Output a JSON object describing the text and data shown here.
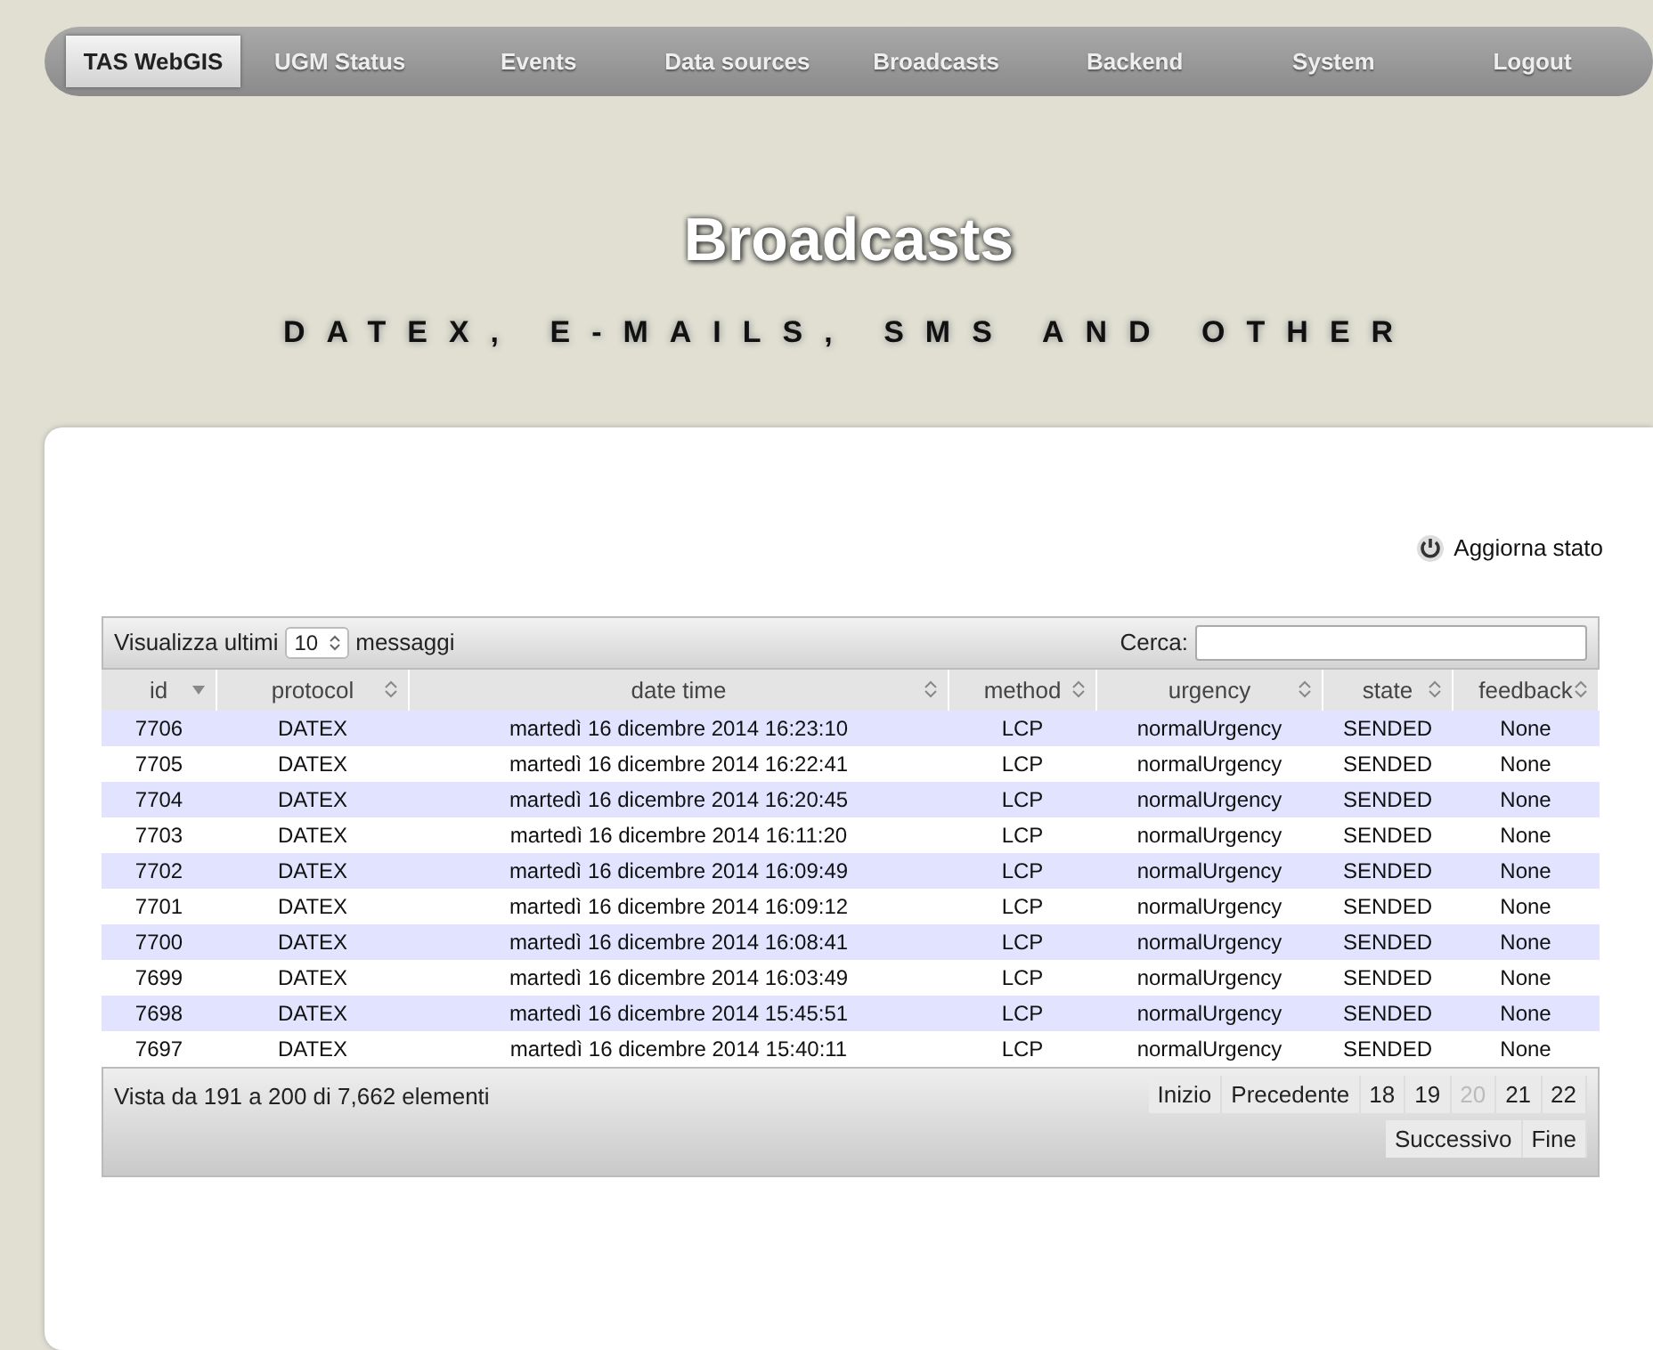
{
  "nav": [
    {
      "label": "TAS WebGIS",
      "selected": true
    },
    {
      "label": "UGM Status",
      "selected": false
    },
    {
      "label": "Events",
      "selected": false
    },
    {
      "label": "Data sources",
      "selected": false
    },
    {
      "label": "Broadcasts",
      "selected": false
    },
    {
      "label": "Backend",
      "selected": false
    },
    {
      "label": "System",
      "selected": false
    },
    {
      "label": "Logout",
      "selected": false
    }
  ],
  "title": "Broadcasts",
  "subtitle": "DATEX, E-MAILS, SMS AND OTHER",
  "refresh": "Aggiorna stato",
  "table": {
    "length_label_before": "Visualizza ultimi",
    "length_value": "10",
    "length_label_after": "messaggi",
    "search_label": "Cerca:",
    "columns": [
      {
        "label": "id",
        "sorted": true
      },
      {
        "label": "protocol",
        "sorted": false
      },
      {
        "label": "date time",
        "sorted": false
      },
      {
        "label": "method",
        "sorted": false
      },
      {
        "label": "urgency",
        "sorted": false
      },
      {
        "label": "state",
        "sorted": false
      },
      {
        "label": "feedback",
        "sorted": false
      }
    ],
    "rows": [
      [
        "7706",
        "DATEX",
        "martedì 16 dicembre 2014 16:23:10",
        "LCP",
        "normalUrgency",
        "SENDED",
        "None"
      ],
      [
        "7705",
        "DATEX",
        "martedì 16 dicembre 2014 16:22:41",
        "LCP",
        "normalUrgency",
        "SENDED",
        "None"
      ],
      [
        "7704",
        "DATEX",
        "martedì 16 dicembre 2014 16:20:45",
        "LCP",
        "normalUrgency",
        "SENDED",
        "None"
      ],
      [
        "7703",
        "DATEX",
        "martedì 16 dicembre 2014 16:11:20",
        "LCP",
        "normalUrgency",
        "SENDED",
        "None"
      ],
      [
        "7702",
        "DATEX",
        "martedì 16 dicembre 2014 16:09:49",
        "LCP",
        "normalUrgency",
        "SENDED",
        "None"
      ],
      [
        "7701",
        "DATEX",
        "martedì 16 dicembre 2014 16:09:12",
        "LCP",
        "normalUrgency",
        "SENDED",
        "None"
      ],
      [
        "7700",
        "DATEX",
        "martedì 16 dicembre 2014 16:08:41",
        "LCP",
        "normalUrgency",
        "SENDED",
        "None"
      ],
      [
        "7699",
        "DATEX",
        "martedì 16 dicembre 2014 16:03:49",
        "LCP",
        "normalUrgency",
        "SENDED",
        "None"
      ],
      [
        "7698",
        "DATEX",
        "martedì 16 dicembre 2014 15:45:51",
        "LCP",
        "normalUrgency",
        "SENDED",
        "None"
      ],
      [
        "7697",
        "DATEX",
        "martedì 16 dicembre 2014 15:40:11",
        "LCP",
        "normalUrgency",
        "SENDED",
        "None"
      ]
    ],
    "info": "Vista da 191 a 200 di 7,662 elementi",
    "pages": [
      {
        "label": "Inizio",
        "selected": false
      },
      {
        "label": "Precedente",
        "selected": false
      },
      {
        "label": "18",
        "selected": false
      },
      {
        "label": "19",
        "selected": false
      },
      {
        "label": "20",
        "selected": true
      },
      {
        "label": "21",
        "selected": false
      },
      {
        "label": "22",
        "selected": false
      },
      {
        "label": "Successivo",
        "selected": false
      },
      {
        "label": "Fine",
        "selected": false
      }
    ]
  }
}
